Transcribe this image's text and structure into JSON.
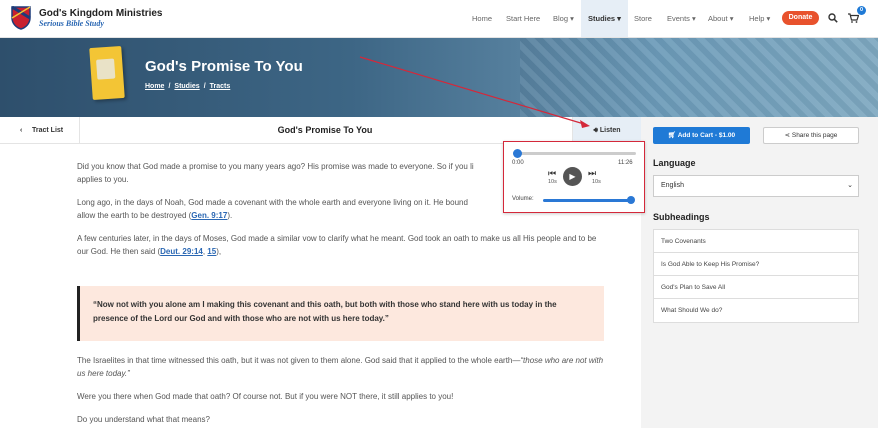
{
  "header": {
    "brand_name": "God's Kingdom Ministries",
    "brand_tagline": "Serious Bible Study",
    "nav": [
      "Home",
      "Start Here",
      "Blog",
      "Studies",
      "Store",
      "Events",
      "About",
      "Help"
    ],
    "nav_active": "Studies",
    "donate_label": "Donate",
    "cart_count": "0",
    "icons": [
      "shield-logo-icon",
      "search-icon",
      "cart-icon"
    ]
  },
  "hero": {
    "title": "God's Promise To You",
    "breadcrumb": [
      "Home",
      "Studies",
      "Tracts"
    ]
  },
  "subbar": {
    "back_label": "Tract List",
    "title": "God's Promise To You",
    "listen_label": "Listen"
  },
  "player": {
    "current_time": "0:00",
    "duration": "11:26",
    "skip_back": "10s",
    "skip_forward": "10s",
    "volume_label": "Volume:",
    "progress": 0,
    "volume": 1
  },
  "article": {
    "p1": "Did you know that God made a promise to you many years ago? His promise was made to everyone. So if you li",
    "p1b": "applies to you.",
    "p2a": "Long ago, in the days of Noah, God made a covenant with the whole earth and everyone living on it. He bound",
    "p2b": "allow the earth to be destroyed (",
    "p2_ref": "Gen. 9:17",
    "p2c": ").",
    "p3a": "A few centuries later, in the days of Moses, God made a similar vow to clarify what he meant. God took an oath to make us all His people and to be our God. He then said (",
    "p3_ref1": "Deut. 29:14",
    "p3_sep": ", ",
    "p3_ref2": "15",
    "p3c": "),",
    "quote": "“Now not with you alone am I making this covenant and this oath, but both with those who stand here with us today in the presence of the Lord our God and with those who are not with us here today.”",
    "p4a": "The Israelites in that time witnessed this oath, but it was not given to them alone. God said that it applied to the whole earth—",
    "p4_em": "“those who are not with us here today.”",
    "p5": "Were you there when God made that oath? Of course not. But if you were NOT there, it still applies to you!",
    "p6": "Do you understand what that means?"
  },
  "sidebar": {
    "cart_label": "Add to Cart - $1.00",
    "share_label": "Share this page",
    "language_heading": "Language",
    "language_value": "English",
    "subheadings_heading": "Subheadings",
    "subheadings": [
      "Two Covenants",
      "Is God Able to Keep His Promise?",
      "God's Plan to Save All",
      "What Should We do?"
    ]
  },
  "colors": {
    "accent": "#1f7ad6",
    "donate": "#e8522d",
    "annotation": "#d4283a",
    "quote_bg": "#fde8de"
  }
}
